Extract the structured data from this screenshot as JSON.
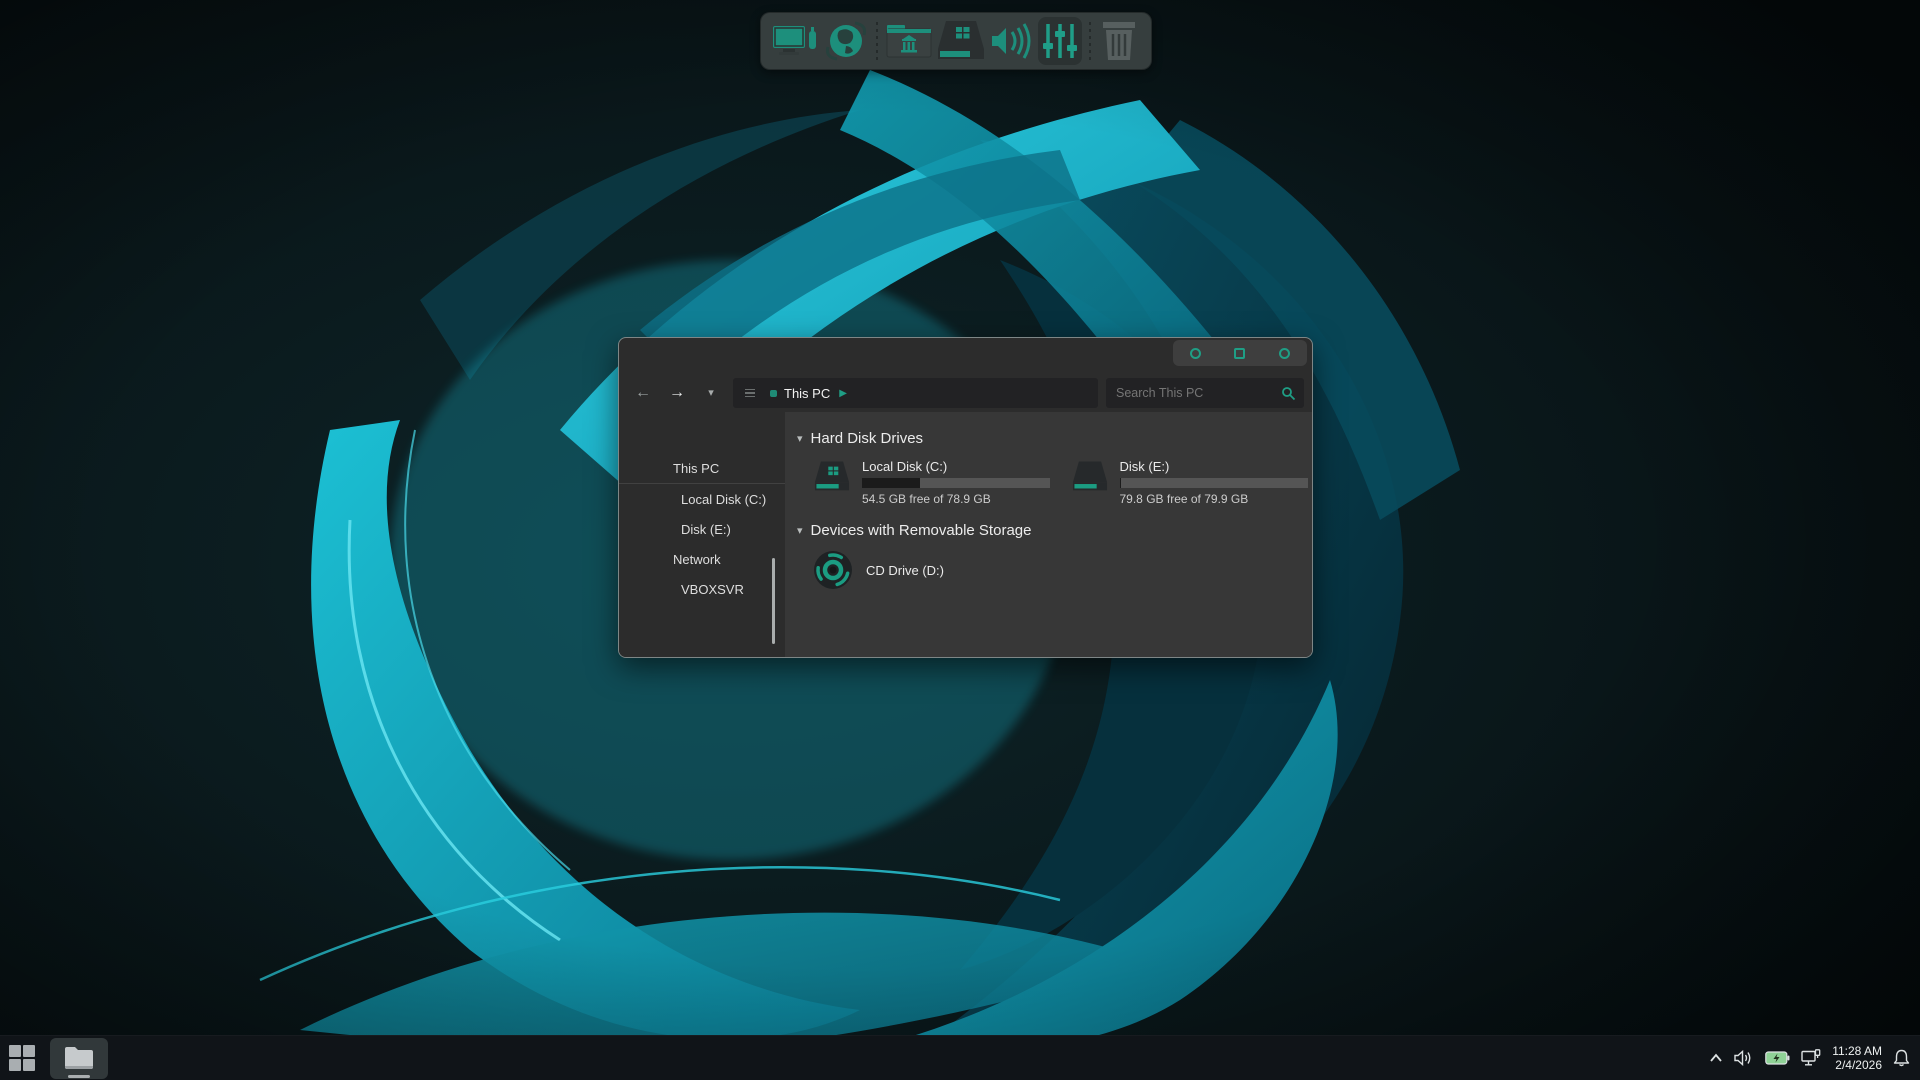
{
  "theme": {
    "accent_teal": "#1f9e85",
    "dock_teal": "#1d8f7c",
    "wallpaper_cyan": "#19b9d4",
    "window_bg": "#2c2c2c",
    "taskbar_bg": "#101418"
  },
  "dock": {
    "icons": [
      "display-and-device-icon",
      "network-globe-icon",
      "shared-folder-icon",
      "boot-drive-icon",
      "audio-speaker-icon",
      "mixer-sliders-icon",
      "trash-icon"
    ],
    "active_tool": "mixer-sliders-icon"
  },
  "explorer": {
    "window_controls": [
      "minimize",
      "maximize",
      "close"
    ],
    "address": {
      "location": "This PC"
    },
    "search": {
      "placeholder": "Search This PC"
    },
    "sidebar": {
      "items": [
        {
          "label": "This PC",
          "indent": 0
        },
        {
          "label": "Local Disk (C:)",
          "indent": 1
        },
        {
          "label": "Disk (E:)",
          "indent": 1
        },
        {
          "label": "Network",
          "indent": 0
        },
        {
          "label": "VBOXSVR",
          "indent": 1
        }
      ]
    },
    "sections": [
      {
        "title": "Hard Disk Drives",
        "drives": [
          {
            "name": "Local Disk (C:)",
            "free_label": "54.5 GB free of 78.9 GB",
            "used_percent": 31,
            "logo": "windows"
          },
          {
            "name": "Disk (E:)",
            "free_label": "79.8 GB free of 79.9 GB",
            "used_percent": 0.6,
            "logo": "none"
          }
        ]
      },
      {
        "title": "Devices with Removable Storage",
        "drives": [
          {
            "name": "CD Drive (D:)"
          }
        ]
      }
    ]
  },
  "taskbar": {
    "apps": [
      "start",
      "file-explorer"
    ],
    "tray": [
      "hidden-icons-chevron",
      "volume",
      "battery-charging",
      "display-connection",
      "notifications-bell"
    ],
    "clock": {
      "time": "11:28 AM",
      "date": "2/4/2026"
    }
  }
}
